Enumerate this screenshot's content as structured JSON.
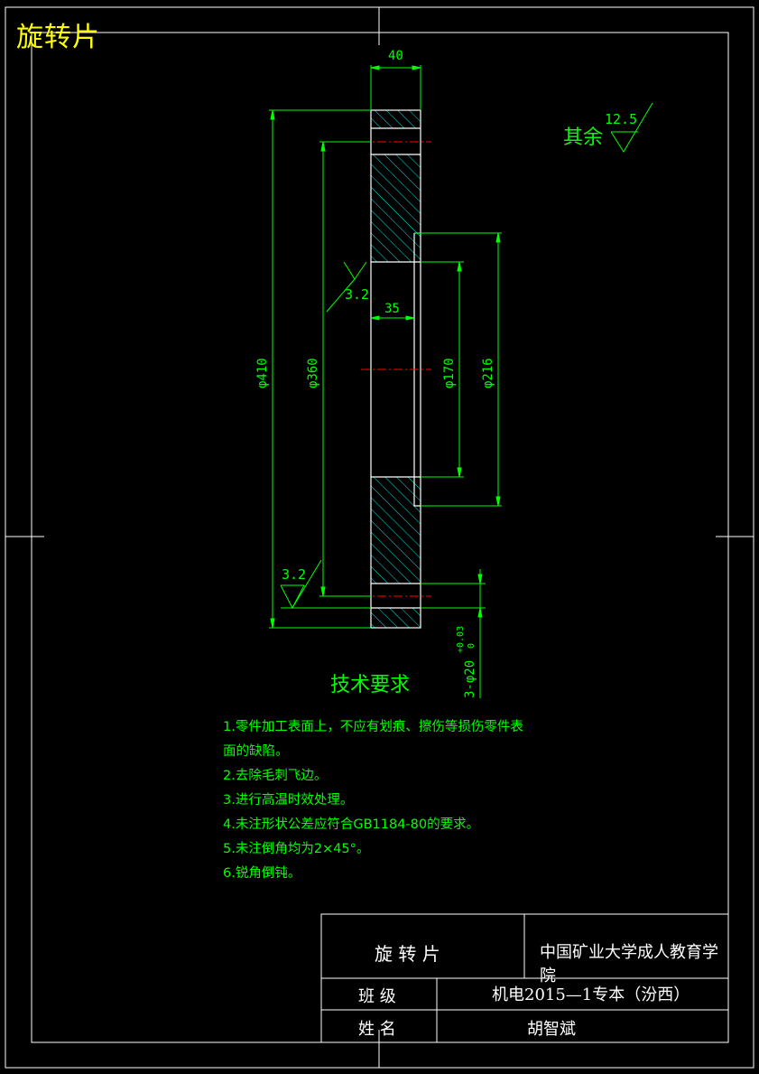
{
  "drawing_title": "旋转片",
  "dimensions": {
    "width_40": "40",
    "width_35": "35",
    "dia_410": "φ410",
    "dia_360": "φ360",
    "dia_170": "φ170",
    "dia_216": "φ216",
    "holes": "3-φ20",
    "hole_tol_upper": "+0.03",
    "hole_tol_lower": "0"
  },
  "roughness": {
    "other_label": "其余",
    "other_value": "12.5",
    "face_upper": "3.2",
    "face_lower": "3.2"
  },
  "tech_requirements": {
    "title": "技术要求",
    "lines": [
      "1.零件加工表面上，不应有划痕、擦伤等损伤零件表",
      "面的缺陷。",
      "2.去除毛刺飞边。",
      "3.进行高温时效处理。",
      "4.未注形状公差应符合GB1184-80的要求。",
      "5.未注倒角均为2×45°。",
      "6.锐角倒钝。"
    ]
  },
  "title_block": {
    "part_name": "旋 转 片",
    "school_line1": "中国矿业大学成人教育学",
    "school_line2": "院",
    "class_label": "班  级",
    "class_value": "机电2015—1专本（汾西）",
    "name_label": "姓  名",
    "name_value": "胡智斌"
  },
  "colors": {
    "background": "#000000",
    "frame": "#ffffff",
    "geometry": "#ffffff",
    "dimension": "#00ff00",
    "hatch": "#00ffff",
    "centerline": "#ff0000",
    "title": "#ffff00"
  }
}
